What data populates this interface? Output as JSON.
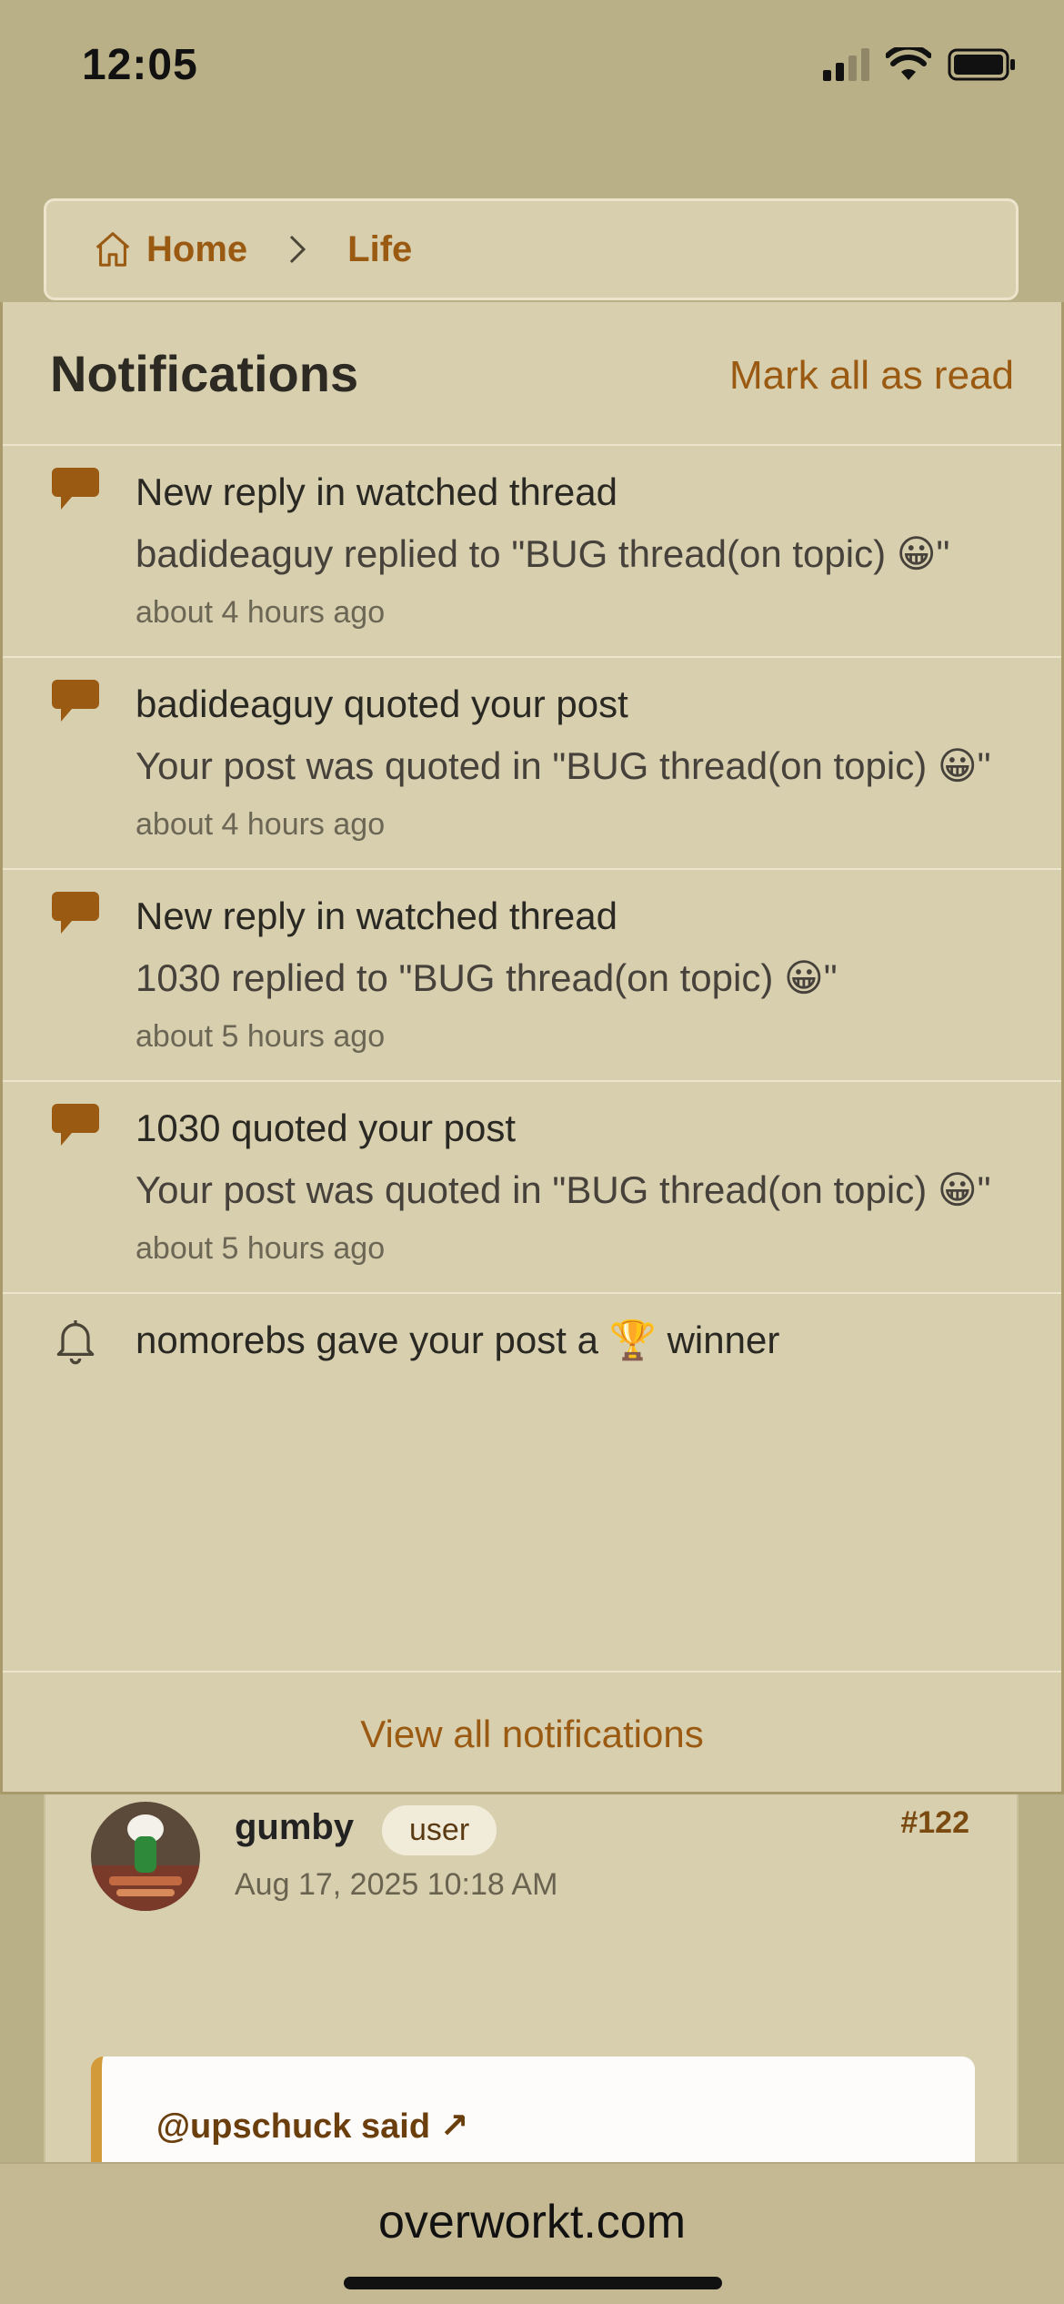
{
  "status_bar": {
    "time": "12:05"
  },
  "breadcrumb": {
    "home_label": "Home",
    "section_label": "Life"
  },
  "notifications": {
    "title": "Notifications",
    "mark_all_label": "Mark all as read",
    "items": [
      {
        "icon": "speech-bubble-icon",
        "title": "New reply in watched thread",
        "body": "badideaguy replied to \"BUG thread(on topic) 😀\"",
        "time": "about 4 hours ago"
      },
      {
        "icon": "speech-bubble-icon",
        "title": "badideaguy quoted your post",
        "body": "Your post was quoted in \"BUG thread(on topic) 😀\"",
        "time": "about 4 hours ago"
      },
      {
        "icon": "speech-bubble-icon",
        "title": "New reply in watched thread",
        "body": "1030 replied to \"BUG thread(on topic) 😀\"",
        "time": "about 5 hours ago"
      },
      {
        "icon": "speech-bubble-icon",
        "title": "1030 quoted your post",
        "body": "Your post was quoted in \"BUG thread(on topic) 😀\"",
        "time": "about 5 hours ago"
      },
      {
        "icon": "bell-icon",
        "title": "nomorebs gave your post a 🏆 winner",
        "body": "",
        "time": ""
      }
    ],
    "view_all_label": "View all notifications"
  },
  "post": {
    "username": "gumby",
    "role": "user",
    "date": "Aug 17, 2025 10:18 AM",
    "number": "#122",
    "quote_author": "@upschuck said ↗"
  },
  "browser": {
    "url": "overworkt.com"
  },
  "colors": {
    "accent": "#9a5a12",
    "background": "#bab087",
    "panel": "#d8cfaf"
  }
}
